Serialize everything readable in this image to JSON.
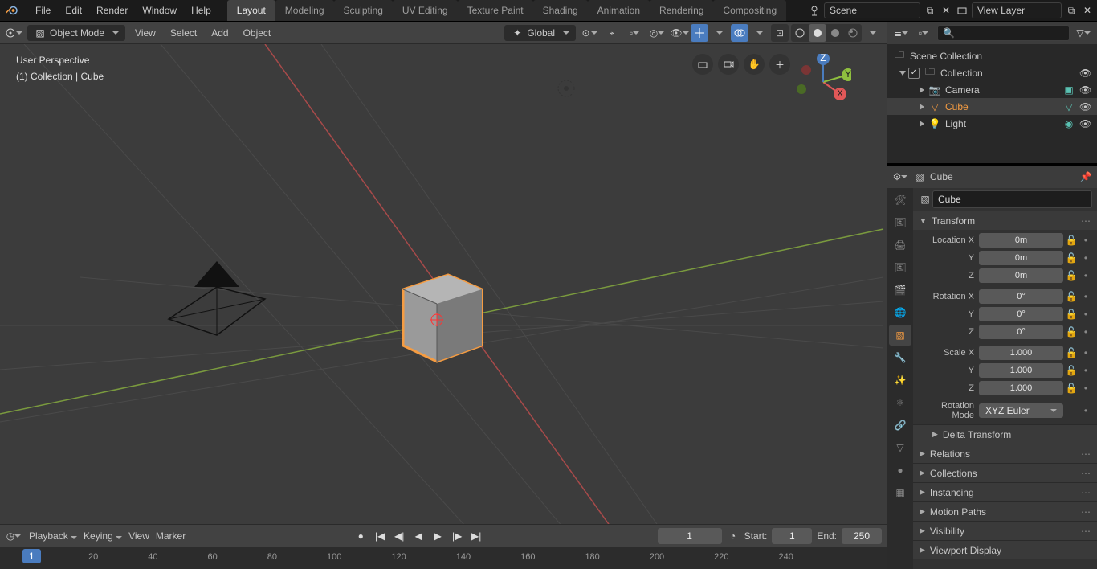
{
  "topbar": {
    "menu": [
      "File",
      "Edit",
      "Render",
      "Window",
      "Help"
    ],
    "tabs": [
      "Layout",
      "Modeling",
      "Sculpting",
      "UV Editing",
      "Texture Paint",
      "Shading",
      "Animation",
      "Rendering",
      "Compositing"
    ],
    "active_tab": 0,
    "scene_field": "Scene",
    "viewlayer_field": "View Layer"
  },
  "viewport_header": {
    "mode": "Object Mode",
    "mode_menus": [
      "View",
      "Select",
      "Add",
      "Object"
    ],
    "orientation": "Global"
  },
  "viewport_info": {
    "line1": "User Perspective",
    "line2": "(1) Collection | Cube"
  },
  "gizmo_axes": {
    "x": "X",
    "y": "Y",
    "z": "Z"
  },
  "outliner": {
    "root": "Scene Collection",
    "collection": "Collection",
    "items": [
      {
        "name": "Camera",
        "type": "camera"
      },
      {
        "name": "Cube",
        "type": "mesh",
        "selected": true
      },
      {
        "name": "Light",
        "type": "light"
      }
    ]
  },
  "properties": {
    "breadcrumb": "Cube",
    "object_name": "Cube",
    "panels": {
      "transform": "Transform",
      "delta": "Delta Transform",
      "relations": "Relations",
      "collections": "Collections",
      "instancing": "Instancing",
      "motion_paths": "Motion Paths",
      "visibility": "Visibility",
      "viewport_display": "Viewport Display"
    },
    "transform": {
      "loc_label": "Location X",
      "loc_y": "Y",
      "loc_z": "Z",
      "rot_label": "Rotation X",
      "rot_y": "Y",
      "rot_z": "Z",
      "scale_label": "Scale X",
      "scale_y": "Y",
      "scale_z": "Z",
      "loc": [
        "0m",
        "0m",
        "0m"
      ],
      "rot": [
        "0°",
        "0°",
        "0°"
      ],
      "scale": [
        "1.000",
        "1.000",
        "1.000"
      ],
      "mode_label": "Rotation Mode",
      "mode_value": "XYZ Euler"
    }
  },
  "timeline": {
    "menus": [
      "Playback",
      "Keying",
      "View",
      "Marker"
    ],
    "current_frame": "1",
    "start_label": "Start:",
    "start_value": "1",
    "end_label": "End:",
    "end_value": "250",
    "ticks": [
      "1",
      "20",
      "40",
      "60",
      "80",
      "100",
      "120",
      "140",
      "160",
      "180",
      "200",
      "220",
      "240"
    ]
  }
}
